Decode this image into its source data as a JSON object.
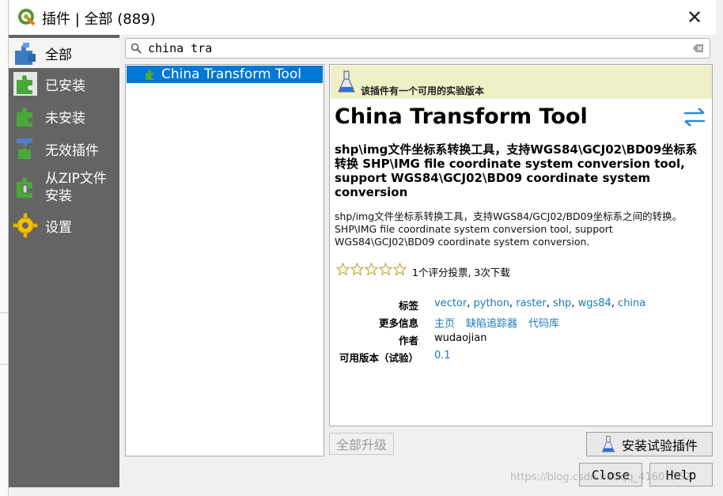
{
  "window": {
    "title": "插件 | 全部 (889)",
    "close_glyph": "✕"
  },
  "sidebar": {
    "items": [
      {
        "label": "全部",
        "icon": "all-plugins-icon"
      },
      {
        "label": "已安装",
        "icon": "installed-icon"
      },
      {
        "label": "未安装",
        "icon": "not-installed-icon"
      },
      {
        "label": "无效插件",
        "icon": "invalid-plugins-icon"
      },
      {
        "label": "从ZIP文件安装",
        "icon": "zip-install-icon"
      },
      {
        "label": "设置",
        "icon": "settings-gear-icon"
      }
    ]
  },
  "search": {
    "value": "china tra"
  },
  "plugin_list": [
    {
      "name": "China Transform Tool"
    }
  ],
  "details": {
    "banner": "该插件有一个可用的实验版本",
    "title": "China Transform Tool",
    "summary": "shp\\img文件坐标系转换工具，支持WGS84\\GCJ02\\BD09坐标系转换 SHP\\IMG file coordinate system conversion tool, support WGS84\\GCJ02\\BD09 coordinate system conversion",
    "description": "shp/img文件坐标系转换工具，支持WGS84/GCJ02/BD09坐标系之间的转换。SHP\\IMG file coordinate system conversion tool, support WGS84\\GCJ02\\BD09 coordinate system conversion.",
    "rating_stars": 0,
    "rating_text": "1个评分投票, 3次下载",
    "tags_label": "标签",
    "tags": [
      "vector",
      "python",
      "raster",
      "shp",
      "wgs84",
      "china"
    ],
    "more_info_label": "更多信息",
    "more_info": [
      "主页",
      "缺陷追踪器",
      "代码库"
    ],
    "author_label": "作者",
    "author": "wudaojian",
    "version_label": "可用版本（试验）",
    "version": "0.1"
  },
  "buttons": {
    "upgrade_all": "全部升级",
    "install_experimental": "安装试验插件",
    "close": "Close",
    "help": "Help"
  },
  "watermark": "https://blog.csdn.net/qq_41601862",
  "colors": {
    "sidebar_bg": "#646464",
    "selection": "#0078d7",
    "banner_bg": "#f0f0c8",
    "link": "#1a7ab8"
  }
}
